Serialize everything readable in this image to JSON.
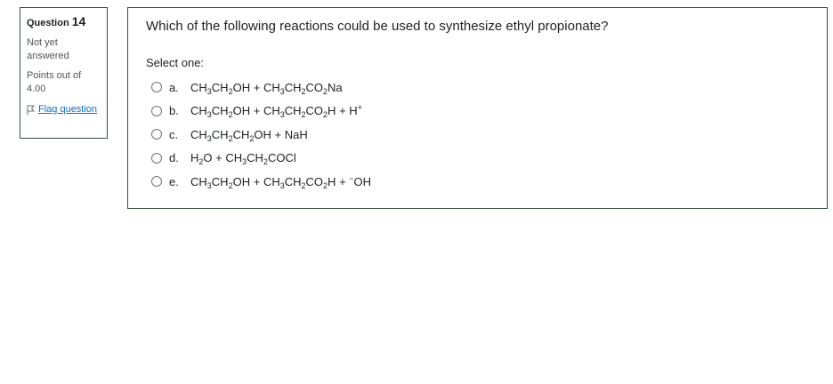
{
  "info": {
    "question_label": "Question",
    "question_number": "14",
    "state": "Not yet answered",
    "grade": "Points out of 4.00",
    "flag_label": "Flag question"
  },
  "question": {
    "text": "Which of the following reactions could be used to synthesize ethyl propionate?",
    "prompt": "Select one:",
    "options": [
      {
        "letter": "a.",
        "answer": "CH3CH2OH + CH3CH2CO2Na"
      },
      {
        "letter": "b.",
        "answer": "CH3CH2OH + CH3CH2CO2H + H+"
      },
      {
        "letter": "c.",
        "answer": "CH3CH2CH2OH + NaH"
      },
      {
        "letter": "d.",
        "answer": "H2O + CH3CH2COCl"
      },
      {
        "letter": "e.",
        "answer": "CH3CH2OH + CH3CH2CO2H + -OH"
      }
    ]
  },
  "colors": {
    "border": "#3a4d3f",
    "link": "#0f6cbf"
  },
  "icons": {
    "flag": "flag-icon",
    "radio": "radio-button"
  }
}
